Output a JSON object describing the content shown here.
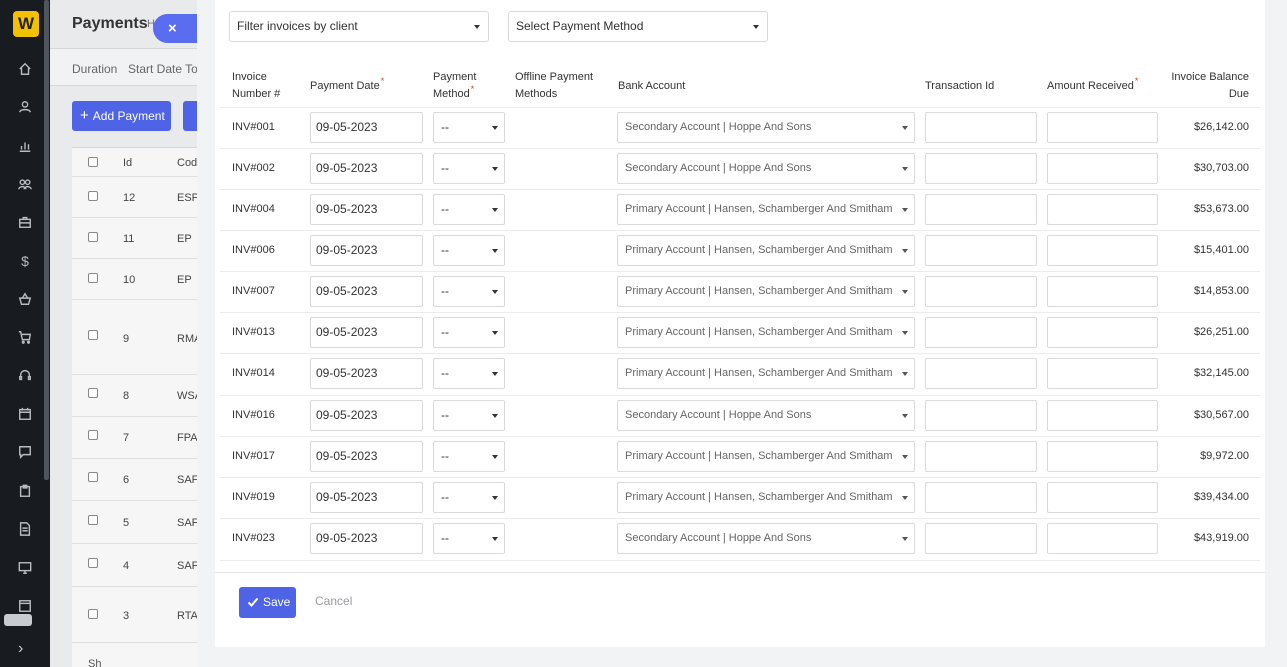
{
  "sidebar": {
    "logo": "W"
  },
  "background": {
    "title": "Payments",
    "help": "H",
    "filters": [
      "Duration",
      "Start Date To"
    ],
    "add_payment_label": "Add Payment",
    "columns": [
      "Id",
      "Cod"
    ],
    "rows": [
      {
        "id": "12",
        "code": "ESP"
      },
      {
        "id": "11",
        "code": "EP"
      },
      {
        "id": "10",
        "code": "EP"
      },
      {
        "id": "9",
        "code": "RMA"
      },
      {
        "id": "8",
        "code": "WSA"
      },
      {
        "id": "7",
        "code": "FPA"
      },
      {
        "id": "6",
        "code": "SAF"
      },
      {
        "id": "5",
        "code": "SAF"
      },
      {
        "id": "4",
        "code": "SAF"
      },
      {
        "id": "3",
        "code": "RTA"
      }
    ],
    "footer_text": "Sh"
  },
  "modal": {
    "close_label": "×",
    "filter_client_placeholder": "Filter invoices by client",
    "filter_method_placeholder": "Select Payment Method",
    "headers": {
      "invoice_number": [
        "Invoice",
        "Number #"
      ],
      "payment_date": "Payment Date",
      "payment_method": [
        "Payment",
        "Method"
      ],
      "offline_methods": [
        "Offline Payment",
        "Methods"
      ],
      "bank_account": "Bank Account",
      "transaction_id": "Transaction Id",
      "amount_received": "Amount Received",
      "balance_due": [
        "Invoice Balance",
        "Due"
      ],
      "required_mark": "*"
    },
    "rows": [
      {
        "invoice": "INV#001",
        "date": "09-05-2023",
        "method": "--",
        "bank": "Secondary Account | Hoppe And Sons",
        "balance": "$26,142.00"
      },
      {
        "invoice": "INV#002",
        "date": "09-05-2023",
        "method": "--",
        "bank": "Secondary Account | Hoppe And Sons",
        "balance": "$30,703.00"
      },
      {
        "invoice": "INV#004",
        "date": "09-05-2023",
        "method": "--",
        "bank": "Primary Account | Hansen, Schamberger And Smitham",
        "balance": "$53,673.00"
      },
      {
        "invoice": "INV#006",
        "date": "09-05-2023",
        "method": "--",
        "bank": "Primary Account | Hansen, Schamberger And Smitham",
        "balance": "$15,401.00"
      },
      {
        "invoice": "INV#007",
        "date": "09-05-2023",
        "method": "--",
        "bank": "Primary Account | Hansen, Schamberger And Smitham",
        "balance": "$14,853.00"
      },
      {
        "invoice": "INV#013",
        "date": "09-05-2023",
        "method": "--",
        "bank": "Primary Account | Hansen, Schamberger And Smitham",
        "balance": "$26,251.00"
      },
      {
        "invoice": "INV#014",
        "date": "09-05-2023",
        "method": "--",
        "bank": "Primary Account | Hansen, Schamberger And Smitham",
        "balance": "$32,145.00"
      },
      {
        "invoice": "INV#016",
        "date": "09-05-2023",
        "method": "--",
        "bank": "Secondary Account | Hoppe And Sons",
        "balance": "$30,567.00"
      },
      {
        "invoice": "INV#017",
        "date": "09-05-2023",
        "method": "--",
        "bank": "Primary Account | Hansen, Schamberger And Smitham",
        "balance": "$9,972.00"
      },
      {
        "invoice": "INV#019",
        "date": "09-05-2023",
        "method": "--",
        "bank": "Primary Account | Hansen, Schamberger And Smitham",
        "balance": "$39,434.00"
      },
      {
        "invoice": "INV#023",
        "date": "09-05-2023",
        "method": "--",
        "bank": "Secondary Account | Hoppe And Sons",
        "balance": "$43,919.00"
      }
    ],
    "save_label": "Save",
    "cancel_label": "Cancel"
  },
  "colors": {
    "accent": "#4f63e7",
    "sidebar": "#181c20",
    "required": "#e53935"
  },
  "icons": [
    "home-icon",
    "user-icon",
    "chart-icon",
    "users-icon",
    "briefcase-icon",
    "dollar-icon",
    "basket-icon",
    "cart-icon",
    "headset-icon",
    "calendar-icon",
    "message-icon",
    "clipboard-icon",
    "document-icon",
    "monitor-icon",
    "window-icon",
    "chevron-right-icon",
    "check-icon",
    "caret-down-icon",
    "close-icon",
    "plus-icon"
  ]
}
